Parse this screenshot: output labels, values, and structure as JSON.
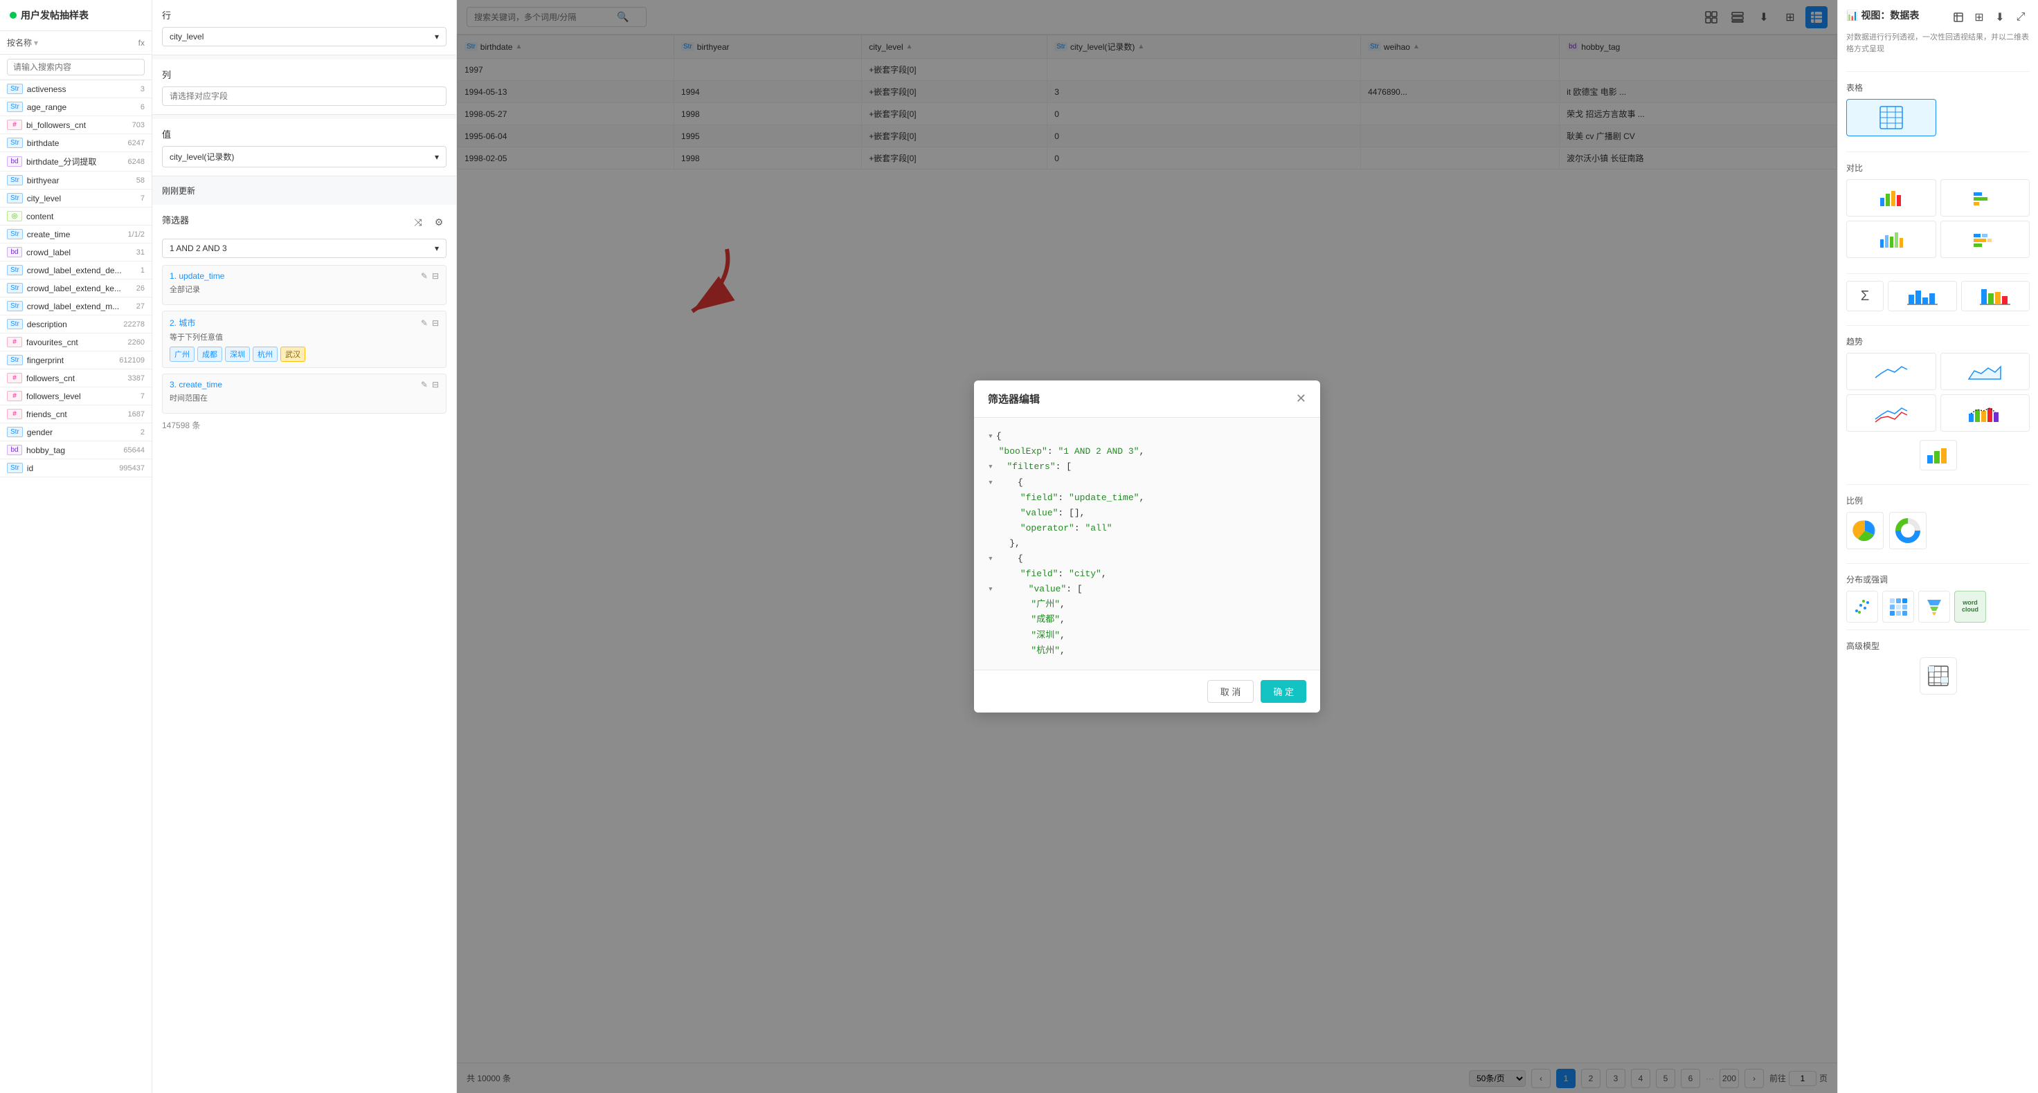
{
  "app": {
    "title": "用户发帖抽样表",
    "view_label": "视图：数据表",
    "view_desc": "对数据进行行列透视，一次性回透视结果，并以二维表格方式呈现"
  },
  "sidebar": {
    "by_name_label": "按名称",
    "fx_label": "fx",
    "search_placeholder": "请输入搜索内容",
    "fields": [
      {
        "type": "Str",
        "tag_class": "tag-str",
        "name": "activeness",
        "count": "3"
      },
      {
        "type": "Str",
        "tag_class": "tag-str",
        "name": "age_range",
        "count": "6"
      },
      {
        "type": "#",
        "tag_class": "tag-num",
        "name": "bi_followers_cnt",
        "count": "703"
      },
      {
        "type": "Str",
        "tag_class": "tag-str",
        "name": "birthdate",
        "count": "6247"
      },
      {
        "type": "bd",
        "tag_class": "tag-arr",
        "name": "birthdate_分词提取",
        "count": "6248"
      },
      {
        "type": "Str",
        "tag_class": "tag-str",
        "name": "birthyear",
        "count": "58"
      },
      {
        "type": "Str",
        "tag_class": "tag-str",
        "name": "city_level",
        "count": "7"
      },
      {
        "type": "◎",
        "tag_class": "tag-geo",
        "name": "content",
        "count": ""
      },
      {
        "type": "Str",
        "tag_class": "tag-str",
        "name": "create_time",
        "count": "1/1/2"
      },
      {
        "type": "bd",
        "tag_class": "tag-arr",
        "name": "crowd_label",
        "count": "31"
      },
      {
        "type": "Str",
        "tag_class": "tag-str",
        "name": "crowd_label_extend_de...",
        "count": "1"
      },
      {
        "type": "Str",
        "tag_class": "tag-str",
        "name": "crowd_label_extend_ke...",
        "count": "26"
      },
      {
        "type": "Str",
        "tag_class": "tag-str",
        "name": "crowd_label_extend_m...",
        "count": "27"
      },
      {
        "type": "Str",
        "tag_class": "tag-str",
        "name": "description",
        "count": "22278"
      },
      {
        "type": "#",
        "tag_class": "tag-num",
        "name": "favourites_cnt",
        "count": "2260"
      },
      {
        "type": "Str",
        "tag_class": "tag-str",
        "name": "fingerprint",
        "count": "612109"
      },
      {
        "type": "#",
        "tag_class": "tag-num",
        "name": "followers_cnt",
        "count": "3387"
      },
      {
        "type": "#",
        "tag_class": "tag-num",
        "name": "followers_level",
        "count": "7"
      },
      {
        "type": "#",
        "tag_class": "tag-num",
        "name": "friends_cnt",
        "count": "1687"
      },
      {
        "type": "Str",
        "tag_class": "tag-str",
        "name": "gender",
        "count": "2"
      },
      {
        "type": "bd",
        "tag_class": "tag-arr",
        "name": "hobby_tag",
        "count": "65644"
      },
      {
        "type": "Str",
        "tag_class": "tag-str",
        "name": "id",
        "count": "995437"
      }
    ]
  },
  "middle": {
    "row_label": "行",
    "col_label": "列",
    "value_label": "值",
    "filter_label": "筛选器",
    "row_dropdown": "city_level",
    "col_placeholder": "请选择对应字段",
    "value_dropdown": "city_level(记录数)",
    "filter_condition": "1 AND 2 AND 3",
    "filter_items": [
      {
        "number": "1.",
        "name": "update_time",
        "desc": "全部记录",
        "tags": []
      },
      {
        "number": "2.",
        "name": "城市",
        "desc": "等于下列任意值",
        "tags": [
          "广州",
          "成都",
          "深圳",
          "杭州",
          "武汉"
        ]
      },
      {
        "number": "3.",
        "name": "create_time",
        "desc": "时间范围在",
        "tags": []
      }
    ],
    "records": "147598 条",
    "just_updated": "刚刚更新"
  },
  "toolbar": {
    "search_placeholder": "搜索关键词，多个词用/分隔",
    "icons": [
      "⊞",
      "⊟",
      "⬇",
      "⊞",
      "⊠"
    ]
  },
  "table": {
    "columns": [
      "Str birthdate",
      "Str birthyear",
      "city_level",
      "Str city_level(记录数)"
    ],
    "col_headers": [
      "bir",
      "birthyear",
      "city_level",
      "city_level(记录数)",
      "Str weihao",
      "bd hobby_tag"
    ],
    "rows": [
      {
        "bir": "1997",
        "year": "",
        "embed": "+嵌套字段[0]",
        "count": "",
        "weihao": "",
        "hobby": ""
      },
      {
        "bir": "1994-05-13",
        "year": "1994",
        "embed": "+嵌套字段[0]",
        "count": "3",
        "weihao": "4476890...",
        "hobby": "it 欧德宝 电影 ..."
      },
      {
        "bir": "1998-05-27",
        "year": "1998",
        "embed": "+嵌套字段[0]",
        "count": "0",
        "weihao": "",
        "hobby": "荣戈  招远方言故事 ..."
      },
      {
        "bir": "1995-06-04",
        "year": "1995",
        "embed": "+嵌套字段[0]",
        "count": "0",
        "weihao": "",
        "hobby": "耿美  cv  广播剧  CV"
      },
      {
        "bir": "1998-02-05",
        "year": "1998",
        "embed": "+嵌套字段[0]",
        "count": "0",
        "weihao": "",
        "hobby": "波尔沃小镇  长征南路"
      }
    ]
  },
  "pagination": {
    "total_label": "共 10000 条",
    "page_size": "50条/页",
    "pages": [
      "1",
      "2",
      "3",
      "4",
      "5",
      "6",
      "...",
      "200"
    ],
    "current_page": "1",
    "jump_prefix": "前往",
    "jump_suffix": "页"
  },
  "right_panel": {
    "view_label": "视图：数据表",
    "desc": "对数据进行行列透视，一次性回透视结果，并以二维表格方式呈现",
    "table_label": "表格",
    "compare_label": "对比",
    "trend_label": "趋势",
    "ratio_label": "比例",
    "distribution_label": "分布或强调",
    "advanced_label": "高级模型",
    "icons_right_top": [
      "⊡",
      "⊞",
      "⬇",
      "⊞",
      "▣"
    ]
  },
  "modal": {
    "title": "筛选器编辑",
    "cancel_label": "取 消",
    "confirm_label": "确 定",
    "json_content": {
      "boolExp": "1 AND 2 AND 3",
      "filters": [
        {
          "field": "update_time",
          "value": [],
          "operator": "all"
        },
        {
          "field": "city",
          "value": [
            "广州",
            "成都",
            "深圳",
            "杭州"
          ]
        }
      ]
    }
  },
  "right_chart_icons": {
    "table_icon": "▦",
    "bar_chart": "📊",
    "line_chart": "📈"
  },
  "colors": {
    "accent": "#1890ff",
    "teal": "#13c2c2",
    "green": "#00c853"
  }
}
